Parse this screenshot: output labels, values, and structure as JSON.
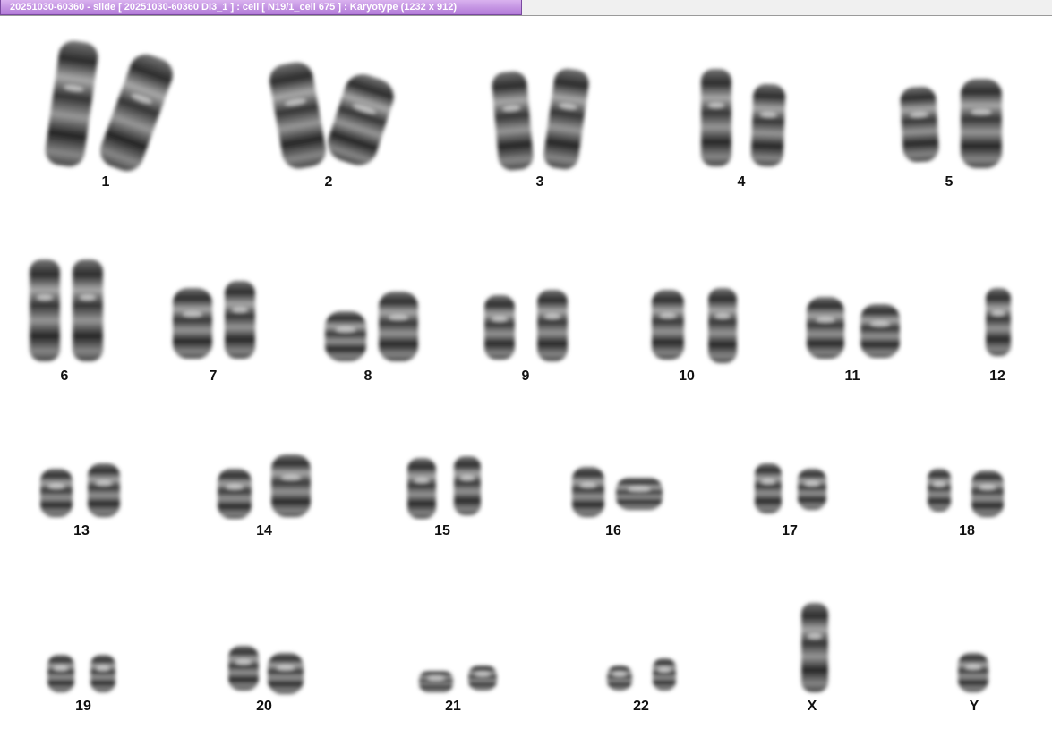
{
  "window": {
    "title": "20251030-60360 - slide [ 20251030-60360 DI3_1 ] : cell [ N19/1_cell 675 ] : Karyotype  (1232 x 912)"
  },
  "karyotype": {
    "labels": {
      "c1": "1",
      "c2": "2",
      "c3": "3",
      "c4": "4",
      "c5": "5",
      "c6": "6",
      "c7": "7",
      "c8": "8",
      "c9": "9",
      "c10": "10",
      "c11": "11",
      "c12": "12",
      "c13": "13",
      "c14": "14",
      "c15": "15",
      "c16": "16",
      "c17": "17",
      "c18": "18",
      "c19": "19",
      "c20": "20",
      "c21": "21",
      "c22": "22",
      "cX": "X",
      "cY": "Y"
    }
  },
  "colors": {
    "title_tab": "#b27ad8",
    "chromosome_dark": "#1a1a1a",
    "chromosome_light": "#9a9a9a",
    "background": "#ffffff"
  }
}
